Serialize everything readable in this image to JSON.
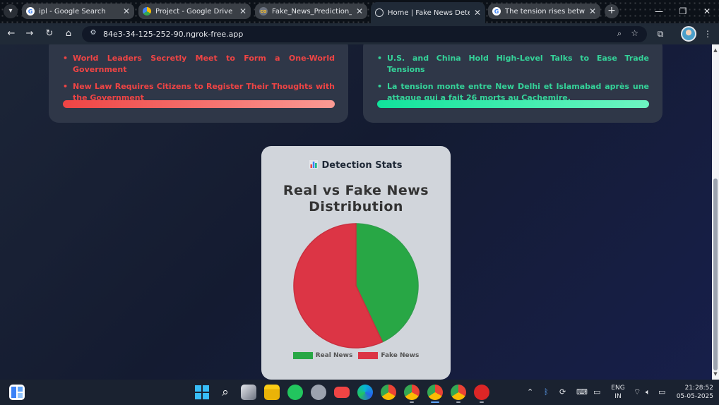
{
  "browser": {
    "tabs": [
      {
        "title": "ipl - Google Search",
        "icon": "google-icon",
        "active": false
      },
      {
        "title": "Project - Google Drive",
        "icon": "google-drive-icon",
        "active": false
      },
      {
        "title": "Fake_News_Prediction_New",
        "icon": "colab-icon",
        "active": false
      },
      {
        "title": "Home | Fake News Detector",
        "icon": "globe-icon",
        "active": true
      },
      {
        "title": "The tension rises between N",
        "icon": "google-icon",
        "active": false
      }
    ],
    "url": "84e3-34-125-252-90.ngrok-free.app"
  },
  "page": {
    "fake_headlines": [
      "World Leaders Secretly Meet to Form a One-World Government",
      "New Law Requires Citizens to Register Their Thoughts with the Government"
    ],
    "real_headlines": [
      "U.S. and China Hold High-Level Talks to Ease Trade Tensions",
      "La tension monte entre New Delhi et Islamabad après une attaque qui a fait 26 morts au Cachemire."
    ],
    "stats_heading": "Detection Stats",
    "colors": {
      "fake": "#dc3545",
      "real": "#28a745"
    }
  },
  "chart_data": {
    "type": "pie",
    "title": "Real vs Fake News Distribution",
    "labels": [
      "Real News",
      "Fake News"
    ],
    "values": [
      43,
      57
    ],
    "colors": [
      "#28a745",
      "#dc3545"
    ],
    "legend": "bottom"
  },
  "taskbar": {
    "lang_top": "ENG",
    "lang_bottom": "IN",
    "time": "21:28:52",
    "date": "05-05-2025"
  }
}
